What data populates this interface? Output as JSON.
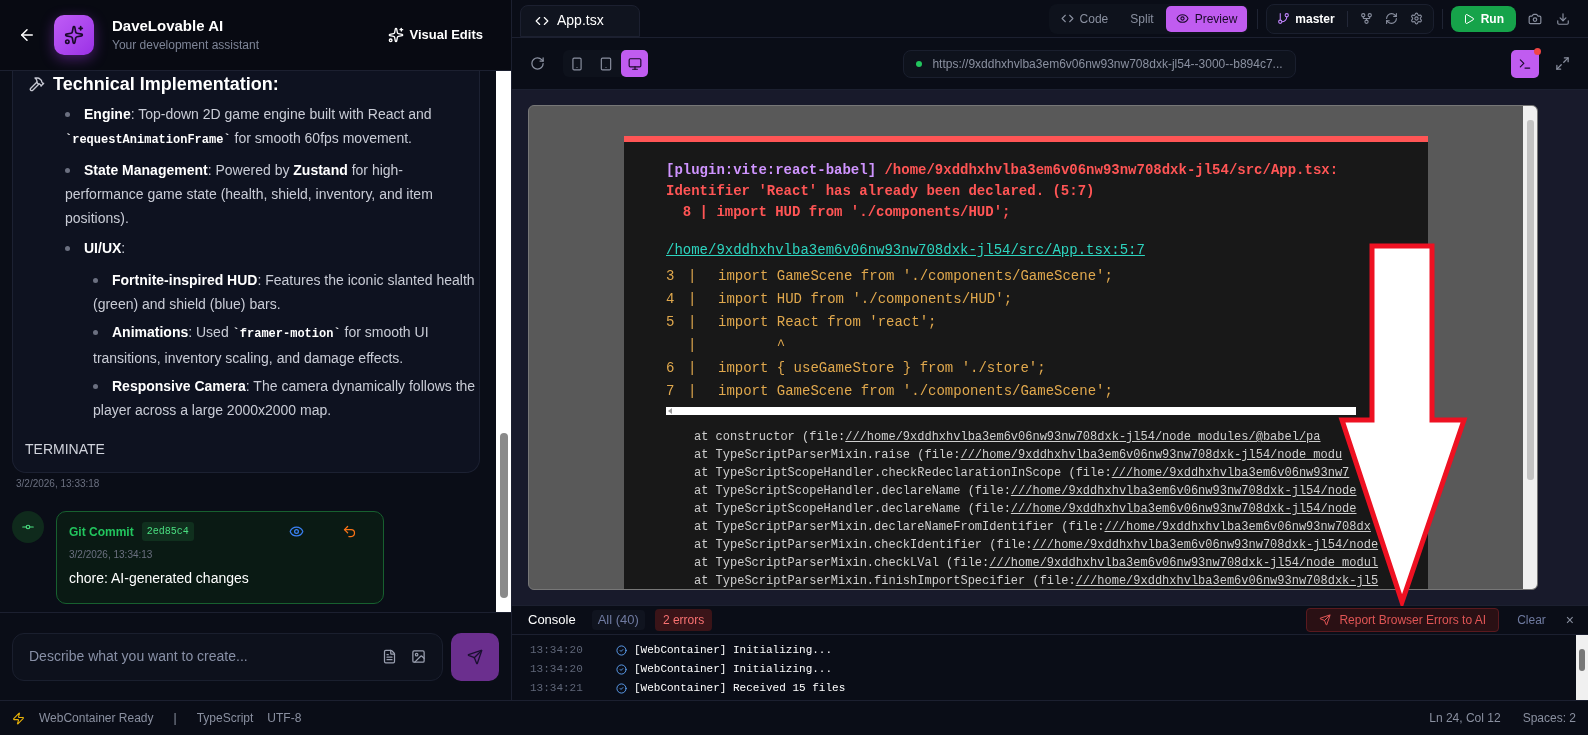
{
  "chat": {
    "header": {
      "title": "DaveLovable AI",
      "subtitle": "Your development assistant",
      "visual_edits": "Visual Edits"
    },
    "message": {
      "heading": "Technical Implementation:",
      "items": [
        {
          "parts": [
            {
              "kind": "bold",
              "text": "Engine"
            },
            {
              "kind": "plain",
              "text": ": Top-down 2D game engine built with React and "
            },
            {
              "kind": "code",
              "text": "`requestAnimationFrame`"
            },
            {
              "kind": "plain",
              "text": " for smooth 60fps movement."
            }
          ]
        },
        {
          "parts": [
            {
              "kind": "bold",
              "text": "State Management"
            },
            {
              "kind": "plain",
              "text": ": Powered by "
            },
            {
              "kind": "bold",
              "text": "Zustand"
            },
            {
              "kind": "plain",
              "text": " for high-performance game state (health, shield, inventory, and item positions)."
            }
          ]
        },
        {
          "parts": [
            {
              "kind": "bold",
              "text": "UI/UX"
            },
            {
              "kind": "plain",
              "text": ":"
            }
          ],
          "children": [
            {
              "parts": [
                {
                  "kind": "bold",
                  "text": "Fortnite-inspired HUD"
                },
                {
                  "kind": "plain",
                  "text": ": Features the iconic slanted health (green) and shield (blue) bars."
                }
              ]
            },
            {
              "parts": [
                {
                  "kind": "bold",
                  "text": "Animations"
                },
                {
                  "kind": "plain",
                  "text": ": Used "
                },
                {
                  "kind": "code",
                  "text": "`framer-motion`"
                },
                {
                  "kind": "plain",
                  "text": " for smooth UI transitions, inventory scaling, and damage effects."
                }
              ]
            },
            {
              "parts": [
                {
                  "kind": "bold",
                  "text": "Responsive Camera"
                },
                {
                  "kind": "plain",
                  "text": ": The camera dynamically follows the player across a large 2000x2000 map."
                }
              ]
            }
          ]
        }
      ],
      "footer": "TERMINATE",
      "time": "3/2/2026, 13:33:18"
    },
    "commit": {
      "title": "Git Commit",
      "hash": "2ed85c4",
      "time": "3/2/2026, 13:34:13",
      "message": "chore: AI-generated changes"
    },
    "input": {
      "placeholder": "Describe what you want to create..."
    }
  },
  "editor": {
    "file_tab": "App.tsx",
    "view_modes": [
      {
        "label": "Code",
        "selected": false
      },
      {
        "label": "Split",
        "selected": false
      },
      {
        "label": "Preview",
        "selected": true
      }
    ],
    "branch": "master",
    "run": "Run",
    "devices": [
      {
        "kind": "phone",
        "selected": false
      },
      {
        "kind": "tablet",
        "selected": false
      },
      {
        "kind": "desktop",
        "selected": true
      }
    ],
    "url": "https://9xddhxhvlba3em6v06nw93nw708dxk-jl54--3000--b894c7...",
    "terminal_alert": true
  },
  "error_overlay": {
    "plugin": "[plugin:vite:react-babel]",
    "path": "/home/9xddhxhvlba3em6v06nw93nw708dxk-jl54/src/App.tsx:",
    "message": "Identifier 'React' has already been declared. (5:7)",
    "excerpt": "  8 | import HUD from './components/HUD';",
    "file_link": "/home/9xddhxhvlba3em6v06nw93nw708dxk-jl54/src/App.tsx:5:7",
    "frame": [
      {
        "num": "3",
        "bar": "|",
        "code": "import GameScene from './components/GameScene';"
      },
      {
        "num": "4",
        "bar": "|",
        "code": "import HUD from './components/HUD';"
      },
      {
        "num": "5",
        "bar": "|",
        "code": "import React from 'react';"
      },
      {
        "bar": "|",
        "code": "       ^"
      },
      {
        "num": "6",
        "bar": "|",
        "code": "import { useGameStore } from './store';"
      },
      {
        "num": "7",
        "bar": "|",
        "code": "import GameScene from './components/GameScene';"
      }
    ],
    "stack": [
      {
        "text": "at constructor (file:",
        "link": "///home/9xddhxhvlba3em6v06nw93nw708dxk-jl54/node_modules/@babel/pa"
      },
      {
        "text": "at TypeScriptParserMixin.raise (file:",
        "link": "///home/9xddhxhvlba3em6v06nw93nw708dxk-jl54/node_modu"
      },
      {
        "text": "at TypeScriptScopeHandler.checkRedeclarationInScope (file:",
        "link": "///home/9xddhxhvlba3em6v06nw93nw7"
      },
      {
        "text": "at TypeScriptScopeHandler.declareName (file:",
        "link": "///home/9xddhxhvlba3em6v06nw93nw708dxk-jl54/node"
      },
      {
        "text": "at TypeScriptScopeHandler.declareName (file:",
        "link": "///home/9xddhxhvlba3em6v06nw93nw708dxk-jl54/node"
      },
      {
        "text": "at TypeScriptParserMixin.declareNameFromIdentifier (file:",
        "link": "///home/9xddhxhvlba3em6v06nw93nw708dx"
      },
      {
        "text": "at TypeScriptParserMixin.checkIdentifier (file:",
        "link": "///home/9xddhxhvlba3em6v06nw93nw708dxk-jl54/node"
      },
      {
        "text": "at TypeScriptParserMixin.checkLVal (file:",
        "link": "///home/9xddhxhvlba3em6v06nw93nw708dxk-jl54/node_modul"
      },
      {
        "text": "at TypeScriptParserMixin.finishImportSpecifier (file:",
        "link": "///home/9xddhxhvlba3em6v06nw93nw708dxk-jl5"
      }
    ]
  },
  "console": {
    "tabs": [
      {
        "label": "Console",
        "selected": true
      },
      {
        "label": "All (40)",
        "selected": false
      }
    ],
    "errors": "2 errors",
    "report": "Report Browser Errors to AI",
    "clear": "Clear",
    "close": "×",
    "lines": [
      {
        "time": "13:34:20",
        "text": "[WebContainer] Initializing..."
      },
      {
        "time": "13:34:20",
        "text": "[WebContainer] Initializing..."
      },
      {
        "time": "13:34:21",
        "text": "[WebContainer] Received 15 files"
      }
    ]
  },
  "status_bar": {
    "left": [
      "WebContainer Ready",
      "|",
      "TypeScript",
      "UTF-8"
    ],
    "right": [
      "Ln 24, Col 12",
      "Spaces: 2"
    ]
  }
}
